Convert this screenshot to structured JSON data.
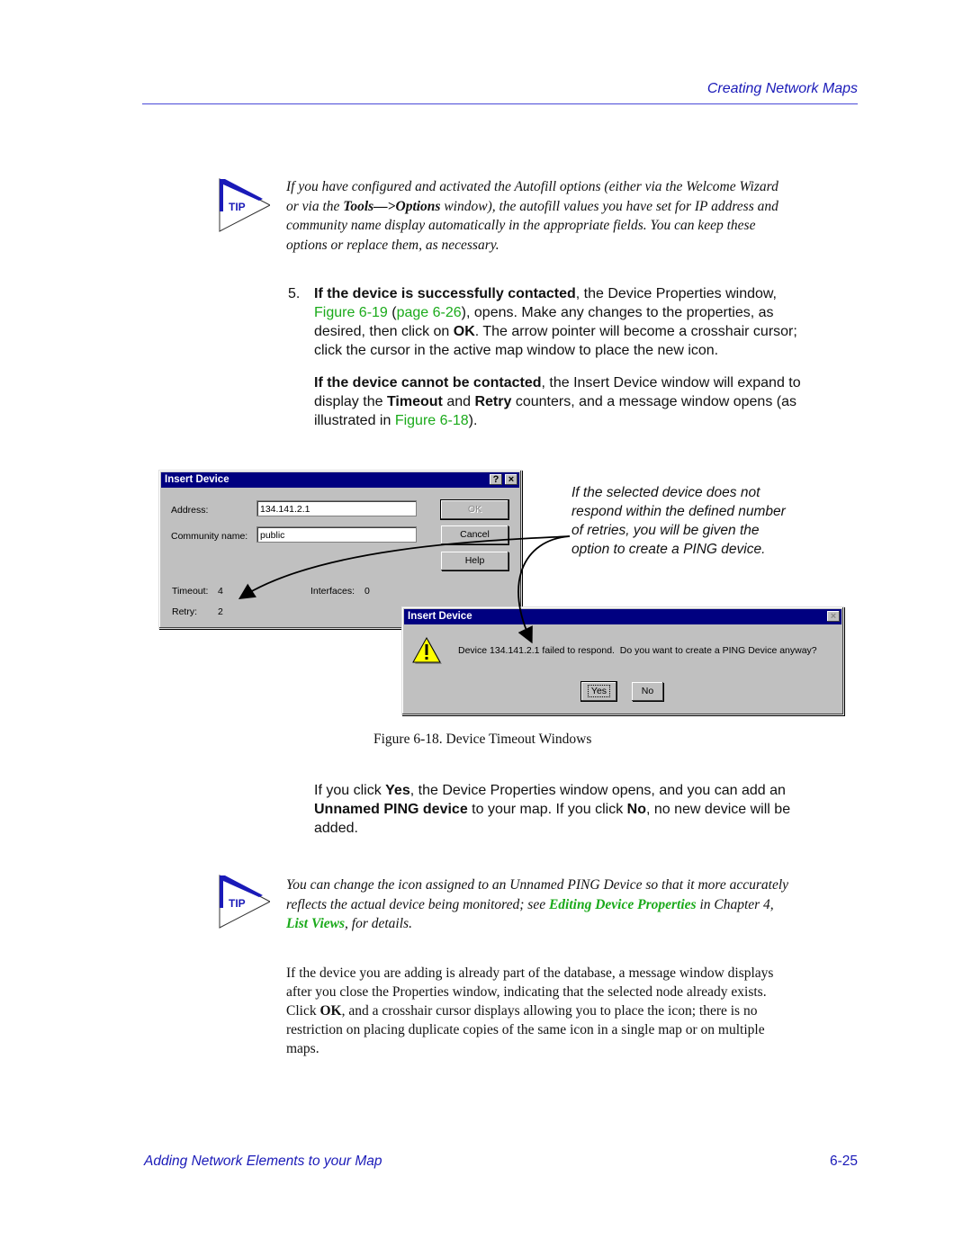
{
  "header": {
    "title": "Creating Network Maps"
  },
  "tip1": {
    "badge": "TIP",
    "icon": "tip-arrow-icon",
    "text_1": "If you have configured and activated the Autofill options (either via the Welcome Wizard",
    "text_2_pre": "or via the ",
    "text_2_bold": "Tools—>Options",
    "text_2_post": " window), the autofill values you have set for IP address and",
    "text_3": "community name display automatically in the appropriate fields. You can keep these",
    "text_4": "options or replace them, as necessary."
  },
  "step5": {
    "number": "5.",
    "p1_bold": "If the device is successfully contacted",
    "p1_a": ", the Device Properties window,",
    "p1_link1": "Figure 6-19",
    "p1_b": " (",
    "p1_link2": "page 6-26",
    "p1_c": "), opens. Make any changes to the properties, as",
    "p1_d": "desired, then click on ",
    "p1_ok": "OK",
    "p1_e": ". The arrow pointer will become a crosshair cursor;",
    "p1_f": "click the cursor in the active map window to place the new icon.",
    "p2_bold": "If the device cannot be contacted",
    "p2_a": ", the Insert Device window will expand to",
    "p2_b": "display the ",
    "p2_timeout": "Timeout",
    "p2_c": " and ",
    "p2_retry": "Retry",
    "p2_d": " counters, and a message window opens (as",
    "p2_e": "illustrated in ",
    "p2_link": "Figure 6-18",
    "p2_f": ")."
  },
  "figure": {
    "dialog1": {
      "title": "Insert Device",
      "help_btn": "?",
      "close_btn": "×",
      "address_label": "Address:",
      "address_value": "134.141.2.1",
      "community_label": "Community name:",
      "community_value": "public",
      "ok": "OK",
      "cancel": "Cancel",
      "help": "Help",
      "timeout_label": "Timeout:",
      "timeout_value": "4",
      "retry_label": "Retry:",
      "retry_value": "2",
      "interfaces_label": "Interfaces:",
      "interfaces_value": "0"
    },
    "dialog2": {
      "title": "Insert Device",
      "close_btn": "×",
      "icon": "warning-icon",
      "message": "Device 134.141.2.1 failed to respond.  Do you want to create a PING Device anyway?",
      "yes": "Yes",
      "no": "No"
    },
    "callout": {
      "line1": "If the selected device does not",
      "line2": "respond within the defined number",
      "line3": "of retries, you will be given the",
      "line4": "option to create a PING device."
    },
    "caption": "Figure 6-18.  Device Timeout Windows"
  },
  "after_figure": {
    "l1_a": "If you click ",
    "l1_yes": "Yes",
    "l1_b": ", the Device Properties window opens, and you can add an",
    "l2_bold": "Unnamed PING device",
    "l2_a": " to your map. If you click ",
    "l2_no": "No",
    "l2_b": ", no new device will be",
    "l3": "added."
  },
  "tip2": {
    "badge": "TIP",
    "icon": "tip-arrow-icon",
    "l1": "You can change the icon assigned to an Unnamed PING Device so that it more accurately",
    "l2_a": "reflects the actual device being monitored; see ",
    "l2_link": "Editing Device Properties",
    "l2_b": " in Chapter 4,",
    "l3_link": "List Views",
    "l3_a": ", for details."
  },
  "final_para": {
    "l1": "If the device you are adding is already part of the database, a message window displays",
    "l2": "after you close the Properties window, indicating that the selected node already exists.",
    "l3_a": "Click ",
    "l3_ok": "OK",
    "l3_b": ", and a crosshair cursor displays allowing you to place the icon; there is no",
    "l4": "restriction on placing duplicate copies of the same icon in a single map or on multiple",
    "l5": "maps."
  },
  "footer": {
    "left": "Adding Network Elements to your Map",
    "right": "6-25"
  },
  "colors": {
    "header_blue": "#1a1ab8",
    "link_green": "#1aaa1a",
    "titlebar": "#000080",
    "dialog_bg": "#c0c0c0"
  }
}
